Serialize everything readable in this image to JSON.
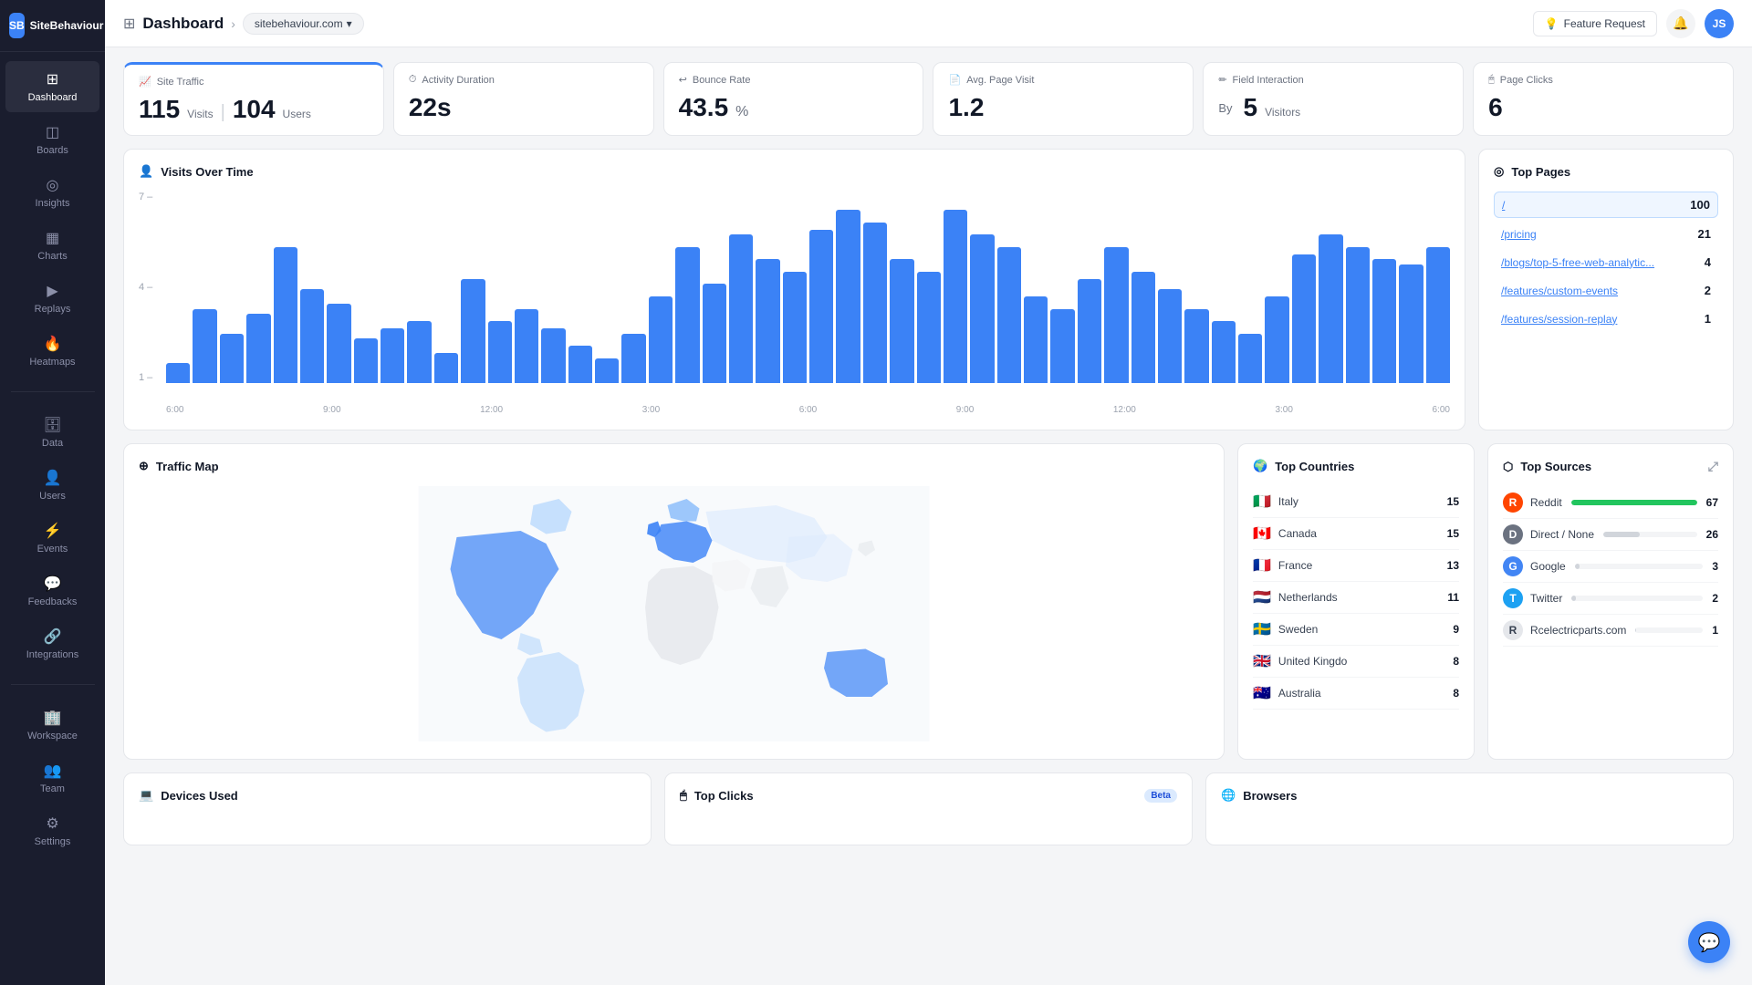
{
  "app": {
    "name": "SiteBehaviour",
    "logo_initials": "SB",
    "user_initials": "JS"
  },
  "header": {
    "title": "Dashboard",
    "domain": "sitebehaviour.com",
    "feature_request": "Feature Request"
  },
  "sidebar": {
    "items": [
      {
        "id": "dashboard",
        "label": "Dashboard",
        "icon": "⊞",
        "active": true
      },
      {
        "id": "boards",
        "label": "Boards",
        "icon": "◫",
        "active": false
      },
      {
        "id": "insights",
        "label": "Insights",
        "icon": "◎",
        "active": false
      },
      {
        "id": "charts",
        "label": "Charts",
        "icon": "📊",
        "active": false
      },
      {
        "id": "replays",
        "label": "Replays",
        "icon": "▶",
        "active": false
      },
      {
        "id": "heatmaps",
        "label": "Heatmaps",
        "icon": "🔥",
        "active": false
      }
    ],
    "divider": true,
    "bottom_items": [
      {
        "id": "data",
        "label": "Data",
        "icon": "🗄",
        "active": false
      },
      {
        "id": "users",
        "label": "Users",
        "icon": "👤",
        "active": false
      },
      {
        "id": "events",
        "label": "Events",
        "icon": "⚡",
        "active": false
      },
      {
        "id": "feedbacks",
        "label": "Feedbacks",
        "icon": "💬",
        "active": false
      },
      {
        "id": "integrations",
        "label": "Integrations",
        "icon": "🔗",
        "active": false
      }
    ],
    "settings_items": [
      {
        "id": "workspace",
        "label": "Workspace",
        "icon": "🏢",
        "active": false
      },
      {
        "id": "team",
        "label": "Team",
        "icon": "👥",
        "active": false
      },
      {
        "id": "settings",
        "label": "Settings",
        "icon": "⚙",
        "active": false
      }
    ]
  },
  "stats": [
    {
      "label": "Site Traffic",
      "value": "115",
      "unit": "Visits",
      "value2": "104",
      "unit2": "Users",
      "color": "#3b82f6"
    },
    {
      "label": "Activity Duration",
      "value": "22s",
      "unit": "",
      "color": "#f87171"
    },
    {
      "label": "Bounce Rate",
      "value": "43.5",
      "unit": "%",
      "color": "#fbbf24"
    },
    {
      "label": "Avg. Page Visit",
      "value": "1.2",
      "unit": "",
      "color": "#a78bfa"
    },
    {
      "label": "Field Interaction",
      "value": "5",
      "prefix": "By",
      "unit": "Visitors",
      "color": "#34d399"
    },
    {
      "label": "Page Clicks",
      "value": "6",
      "unit": "",
      "color": "#60a5fa"
    }
  ],
  "visits_chart": {
    "title": "Visits Over Time",
    "y_labels": [
      "7 –",
      "4 –",
      "1 –"
    ],
    "x_labels": [
      "6:00",
      "9:00",
      "12:00",
      "3:00",
      "6:00",
      "9:00",
      "12:00",
      "3:00",
      "6:00"
    ],
    "bars": [
      8,
      30,
      20,
      28,
      55,
      38,
      32,
      18,
      22,
      25,
      12,
      42,
      25,
      30,
      22,
      15,
      10,
      20,
      35,
      55,
      40,
      60,
      50,
      45,
      62,
      70,
      65,
      50,
      45,
      70,
      60,
      55,
      35,
      30,
      42,
      55,
      45,
      38,
      30,
      25,
      20,
      35,
      52,
      60,
      55,
      50,
      48,
      55
    ]
  },
  "top_pages": {
    "title": "Top Pages",
    "pages": [
      {
        "url": "/",
        "count": 100,
        "highlight": true
      },
      {
        "url": "/pricing",
        "count": 21,
        "highlight": false
      },
      {
        "url": "/blogs/top-5-free-web-analytic...",
        "count": 4,
        "highlight": false
      },
      {
        "url": "/features/custom-events",
        "count": 2,
        "highlight": false
      },
      {
        "url": "/features/session-replay",
        "count": 1,
        "highlight": false
      }
    ]
  },
  "top_countries": {
    "title": "Top Countries",
    "countries": [
      {
        "name": "Italy",
        "flag": "🇮🇹",
        "count": 15
      },
      {
        "name": "Canada",
        "flag": "🇨🇦",
        "count": 15
      },
      {
        "name": "France",
        "flag": "🇫🇷",
        "count": 13
      },
      {
        "name": "Netherlands",
        "flag": "🇳🇱",
        "count": 11
      },
      {
        "name": "Sweden",
        "flag": "🇸🇪",
        "count": 9
      },
      {
        "name": "United Kingdo",
        "flag": "🇬🇧",
        "count": 8
      },
      {
        "name": "Australia",
        "flag": "🇦🇺",
        "count": 8
      }
    ]
  },
  "top_sources": {
    "title": "Top Sources",
    "sources": [
      {
        "name": "Reddit",
        "icon": "R",
        "icon_bg": "#ff4500",
        "icon_color": "#fff",
        "count": 67,
        "bar": 100,
        "top": true
      },
      {
        "name": "Direct / None",
        "icon": "D",
        "icon_bg": "#6b7280",
        "icon_color": "#fff",
        "count": 26,
        "bar": 39,
        "top": false
      },
      {
        "name": "Google",
        "icon": "G",
        "icon_bg": "#4285f4",
        "icon_color": "#fff",
        "count": 3,
        "bar": 4,
        "top": false
      },
      {
        "name": "Twitter",
        "icon": "T",
        "icon_bg": "#1da1f2",
        "icon_color": "#fff",
        "count": 2,
        "bar": 3,
        "top": false
      },
      {
        "name": "Rcelectricparts.com",
        "icon": "R",
        "icon_bg": "#e5e7eb",
        "icon_color": "#374151",
        "count": 1,
        "bar": 1,
        "top": false
      }
    ]
  },
  "traffic_map": {
    "title": "Traffic Map"
  },
  "bottom_cards": [
    {
      "title": "Devices Used",
      "beta": false
    },
    {
      "title": "Top Clicks",
      "beta": true
    },
    {
      "title": "Browsers",
      "beta": false
    }
  ]
}
